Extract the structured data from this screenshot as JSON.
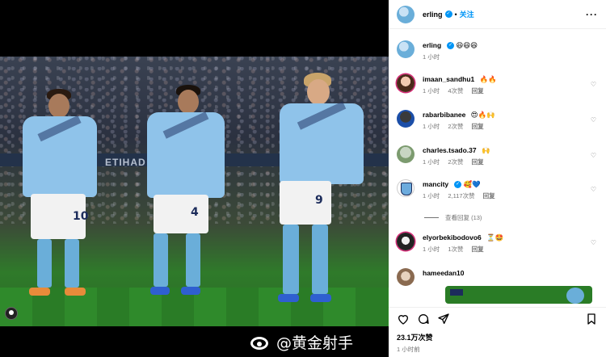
{
  "header": {
    "username": "erling",
    "dot": "•",
    "follow_label": "关注",
    "more_label": "···"
  },
  "caption": {
    "username": "erling",
    "text": "😆😆😆",
    "time": "1 小时"
  },
  "comments": [
    {
      "username": "imaan_sandhu1",
      "text": "🔥🔥",
      "time": "1 小时",
      "likes": "4次赞",
      "reply": "回复"
    },
    {
      "username": "rabarbibanee",
      "text": "😍🔥🙌",
      "time": "1 小时",
      "likes": "2次赞",
      "reply": "回复"
    },
    {
      "username": "charles.tsado.37",
      "text": "🙌",
      "time": "1 小时",
      "likes": "2次赞",
      "reply": "回复"
    },
    {
      "username": "mancity",
      "text": "🥰💙",
      "time": "1 小时",
      "likes": "2,117次赞",
      "reply": "回复",
      "verified": true
    },
    {
      "username": "elyorbekibodovo6",
      "text": "⏳🤩",
      "time": "1 小时",
      "likes": "1次赞",
      "reply": "回复"
    },
    {
      "username": "hameedan10",
      "text": "",
      "time": "",
      "likes": "",
      "reply": ""
    }
  ],
  "view_replies": "查看回复 (13)",
  "post": {
    "like_count": "23.1万次赞",
    "time": "1 小时前"
  },
  "media": {
    "board_text": "ETIHAD STADIUM",
    "shirt_sponsor": "ETIHAD",
    "numbers": [
      "10",
      "4",
      "9"
    ]
  },
  "watermark": {
    "text": "@黄金射手"
  },
  "colors": {
    "accent": "#0095f6",
    "muted": "#737373",
    "city_blue": "#6cabdd"
  }
}
